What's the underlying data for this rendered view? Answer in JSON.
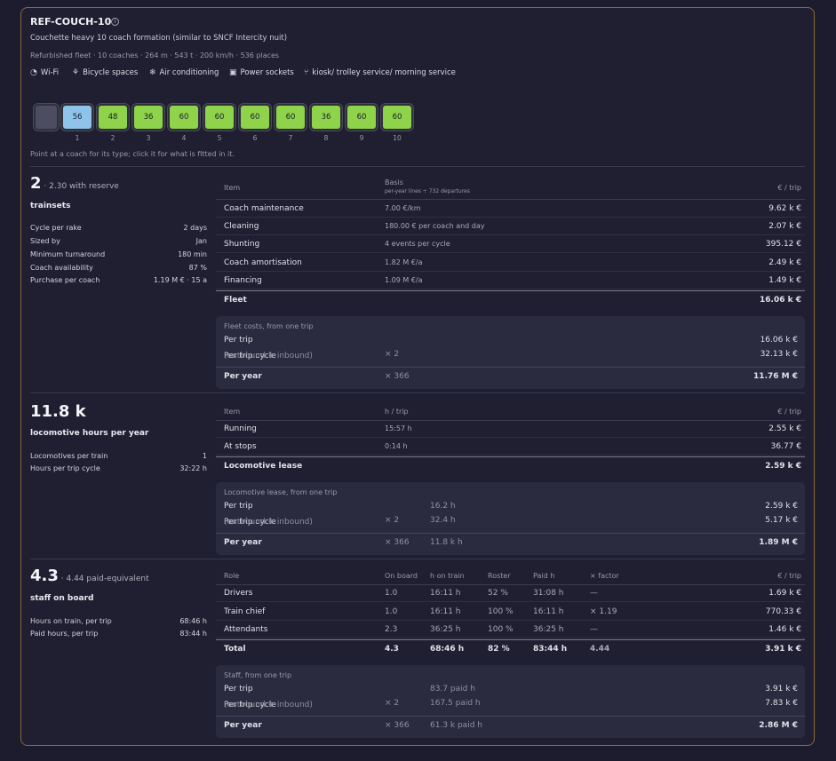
{
  "header": {
    "title": "REF-COUCH-10",
    "info_icon": "i",
    "description": "Couchette heavy 10 coach formation (similar to SNCF Intercity nuit)",
    "specs": "Refurbished fleet · 10 coaches · 264 m · 543 t · 200 km/h · 536 places",
    "amenities": [
      {
        "icon": "wifi-icon",
        "label": "Wi-Fi"
      },
      {
        "icon": "bicycle-icon",
        "label": "Bicycle spaces"
      },
      {
        "icon": "air-conditioning-icon",
        "label": "Air conditioning"
      },
      {
        "icon": "power-socket-icon",
        "label": "Power sockets"
      },
      {
        "icon": "fork-knife-icon",
        "label": "kiosk/ trolley service/ morning service"
      }
    ]
  },
  "formation": {
    "coaches": [
      {
        "seats": "56",
        "num": "1",
        "color": "#8ec4ea"
      },
      {
        "seats": "48",
        "num": "2",
        "color": "#8ed34a"
      },
      {
        "seats": "36",
        "num": "3",
        "color": "#8ed34a"
      },
      {
        "seats": "60",
        "num": "4",
        "color": "#8ed34a"
      },
      {
        "seats": "60",
        "num": "5",
        "color": "#8ed34a"
      },
      {
        "seats": "60",
        "num": "6",
        "color": "#8ed34a"
      },
      {
        "seats": "60",
        "num": "7",
        "color": "#8ed34a"
      },
      {
        "seats": "36",
        "num": "8",
        "color": "#8ed34a"
      },
      {
        "seats": "60",
        "num": "9",
        "color": "#8ed34a"
      },
      {
        "seats": "60",
        "num": "10",
        "color": "#8ed34a"
      }
    ],
    "hint": "Point at a coach for its type; click it for what is fitted in it."
  },
  "trainsets": {
    "value": "2",
    "aside": "· 2.30 with reserve",
    "label": "trainsets",
    "params": [
      {
        "k": "Cycle per rake",
        "v": "2 days"
      },
      {
        "k": "Sized by",
        "v": "Jan"
      },
      {
        "k": "Minimum turnaround",
        "v": "180 min"
      },
      {
        "k": "Coach availability",
        "v": "87 %"
      },
      {
        "k": "Purchase per coach",
        "v": "1.19 M € · 15 a"
      }
    ],
    "table": {
      "h_item": "Item",
      "h_basis": "Basis",
      "h_basis_sub": "per-year lines ÷ 732 departures",
      "h_value": "€ / trip",
      "rows": [
        {
          "item": "Coach maintenance",
          "basis": "7.00 €/km",
          "value": "9.62 k €"
        },
        {
          "item": "Cleaning",
          "basis": "180.00 € per coach and day",
          "value": "2.07 k €"
        },
        {
          "item": "Shunting",
          "basis": "4 events per cycle",
          "value": "395.12 €"
        },
        {
          "item": "Coach amortisation",
          "basis": "1.82 M €/a",
          "value": "2.49 k €"
        },
        {
          "item": "Financing",
          "basis": "1.09 M €/a",
          "value": "1.49 k €"
        }
      ],
      "total_label": "Fleet",
      "total_value": "16.06 k €"
    },
    "summary": {
      "title": "Fleet costs, from one trip",
      "per_trip_label": "Per trip",
      "per_trip_value": "16.06 k €",
      "cycle_label": "Per trip cycle",
      "cycle_note": "(outbound + inbound)",
      "cycle_mult": "× 2",
      "cycle_value": "32.13 k €",
      "year_label": "Per year",
      "year_mult": "× 366",
      "year_value": "11.76 M €"
    }
  },
  "locomotive": {
    "value": "11.8 k",
    "label": "locomotive hours per year",
    "params": [
      {
        "k": "Locomotives per train",
        "v": "1"
      },
      {
        "k": "Hours per trip cycle",
        "v": "32:22 h"
      }
    ],
    "table": {
      "h_item": "Item",
      "h_basis": "h / trip",
      "h_value": "€ / trip",
      "rows": [
        {
          "item": "Running",
          "basis": "15:57 h",
          "value": "2.55 k €"
        },
        {
          "item": "At stops",
          "basis": "0:14 h",
          "value": "36.77 €"
        }
      ],
      "total_label": "Locomotive lease",
      "total_value": "2.59 k €"
    },
    "summary": {
      "title": "Locomotive lease, from one trip",
      "per_trip_label": "Per trip",
      "per_trip_hours": "16.2 h",
      "per_trip_value": "2.59 k €",
      "cycle_label": "Per trip cycle",
      "cycle_note": "(outbound + inbound)",
      "cycle_mult": "× 2",
      "cycle_hours": "32.4 h",
      "cycle_value": "5.17 k €",
      "year_label": "Per year",
      "year_mult": "× 366",
      "year_hours": "11.8 k h",
      "year_value": "1.89 M €"
    }
  },
  "staff": {
    "value": "4.3",
    "aside": "· 4.44 paid-equivalent",
    "label": "staff on board",
    "params": [
      {
        "k": "Hours on train, per trip",
        "v": "68:46 h"
      },
      {
        "k": "Paid hours, per trip",
        "v": "83:44 h"
      }
    ],
    "table": {
      "h_role": "Role",
      "h_onboard": "On board",
      "h_htrain": "h on train",
      "h_roster": "Roster",
      "h_paid": "Paid h",
      "h_factor": "× factor",
      "h_value": "€ / trip",
      "rows": [
        {
          "role": "Drivers",
          "onboard": "1.0",
          "htrain": "16:11 h",
          "roster": "52 %",
          "paid": "31:08 h",
          "factor": "—",
          "value": "1.69 k €"
        },
        {
          "role": "Train chief",
          "onboard": "1.0",
          "htrain": "16:11 h",
          "roster": "100 %",
          "paid": "16:11 h",
          "factor": "× 1.19",
          "value": "770.33 €"
        },
        {
          "role": "Attendants",
          "onboard": "2.3",
          "htrain": "36:25 h",
          "roster": "100 %",
          "paid": "36:25 h",
          "factor": "—",
          "value": "1.46 k €"
        }
      ],
      "total": {
        "role": "Total",
        "onboard": "4.3",
        "htrain": "68:46 h",
        "roster": "82 %",
        "paid": "83:44 h",
        "factor": "4.44",
        "value": "3.91 k €"
      }
    },
    "summary": {
      "title": "Staff, from one trip",
      "per_trip_label": "Per trip",
      "per_trip_hours": "83.7 paid h",
      "per_trip_value": "3.91 k €",
      "cycle_label": "Per trip cycle",
      "cycle_note": "(outbound + inbound)",
      "cycle_mult": "× 2",
      "cycle_hours": "167.5 paid h",
      "cycle_value": "7.83 k €",
      "year_label": "Per year",
      "year_mult": "× 366",
      "year_hours": "61.3 k paid h",
      "year_value": "2.86 M €"
    }
  }
}
